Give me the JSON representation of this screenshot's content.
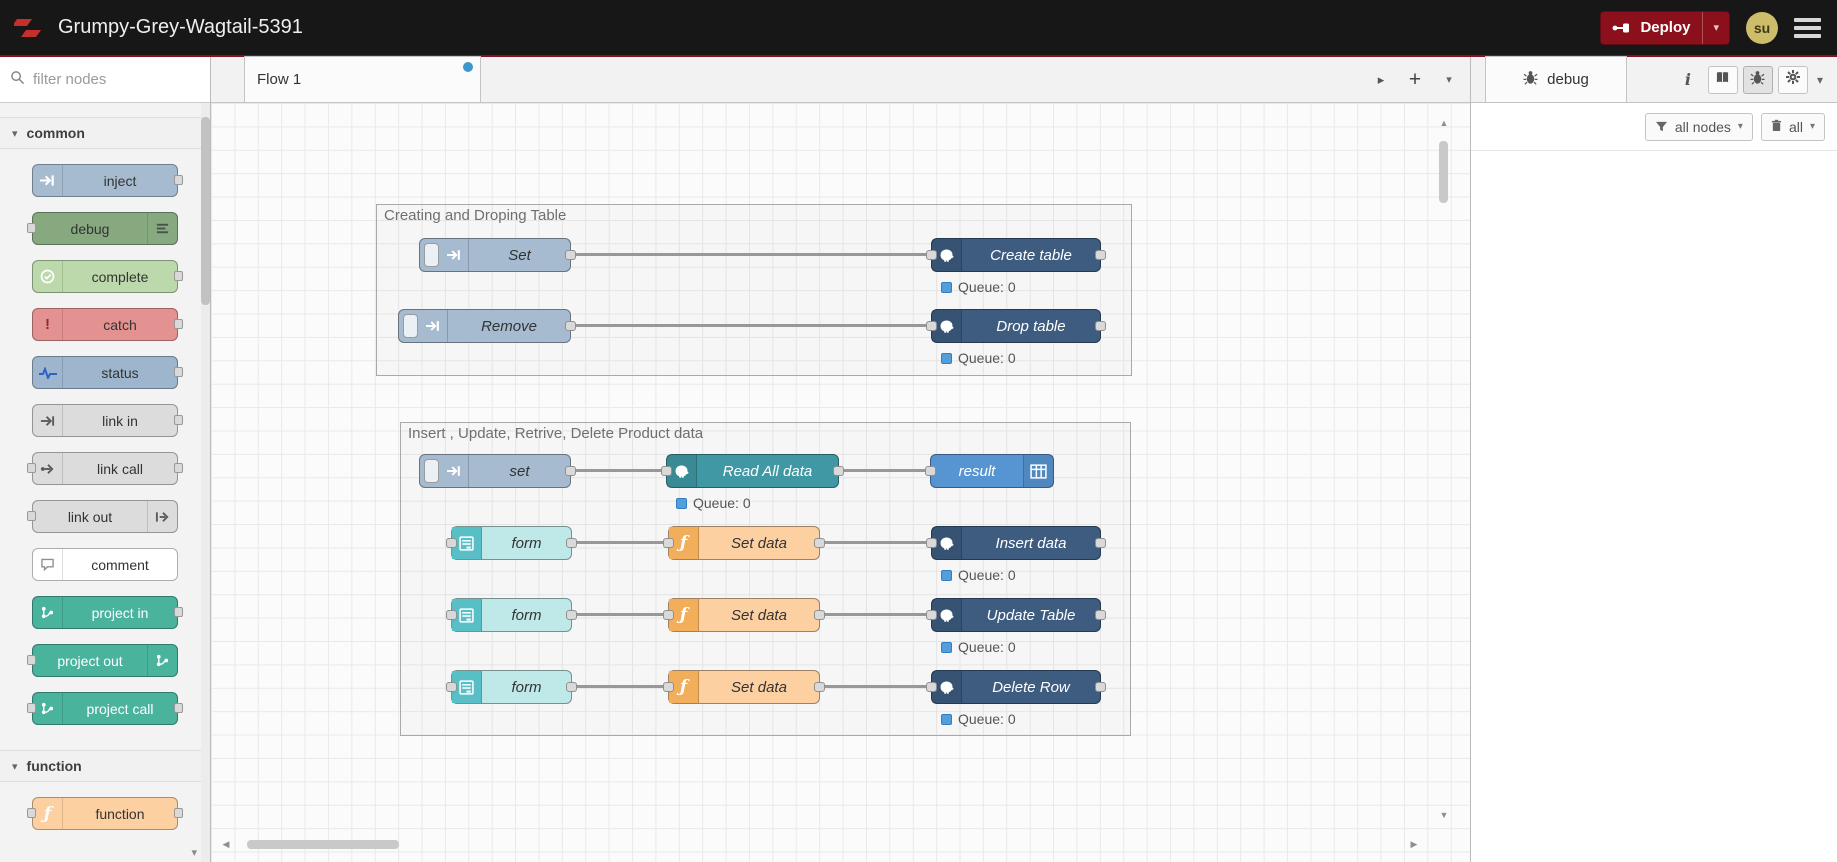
{
  "colors": {
    "header_bg": "#171717",
    "deploy_red": "#8C101C",
    "logo_red": "#C4302B",
    "tab_modified_dot": "#3E97CC",
    "status_dot_blue": "#549EDB",
    "node_inject": "#A6BBCF",
    "node_debug": "#87A980",
    "node_complete": "#BCD9AC",
    "node_catch": "#E49191",
    "node_link": "#DCDCDC",
    "node_comment": "#FFFFFF",
    "node_project": "#49B39C",
    "node_function": "#FDD0A2",
    "node_postgres_dark": "#3D5C80",
    "node_postgres_teal": "#3F98A3",
    "node_result_blue": "#5795D2",
    "node_form": "#BFE9E9"
  },
  "header": {
    "title": "Grumpy-Grey-Wagtail-5391",
    "deploy_label": "Deploy",
    "user_initials": "su"
  },
  "palette": {
    "filter_placeholder": "filter nodes",
    "sections": [
      {
        "label": "common",
        "items": [
          "inject",
          "debug",
          "complete",
          "catch",
          "status",
          "link in",
          "link call",
          "link out",
          "comment",
          "project in",
          "project out",
          "project call"
        ]
      },
      {
        "label": "function",
        "items": [
          "function"
        ]
      }
    ]
  },
  "workspace": {
    "tab_label": "Flow 1",
    "groups": [
      {
        "title": "Creating and Droping Table"
      },
      {
        "title": "Insert , Update, Retrive, Delete Product data"
      }
    ],
    "nodes": {
      "set_upper": "Set",
      "remove": "Remove",
      "create_table": "Create table",
      "drop_table": "Drop table",
      "set_lower": "set",
      "read_all": "Read All data",
      "result": "result",
      "form": "form",
      "set_data": "Set data",
      "insert_data": "Insert data",
      "update_table": "Update Table",
      "delete_row": "Delete Row"
    },
    "status_queue": "Queue: 0"
  },
  "debug_sidebar": {
    "tab_label": "debug",
    "filter_label": "all nodes",
    "clear_label": "all"
  }
}
